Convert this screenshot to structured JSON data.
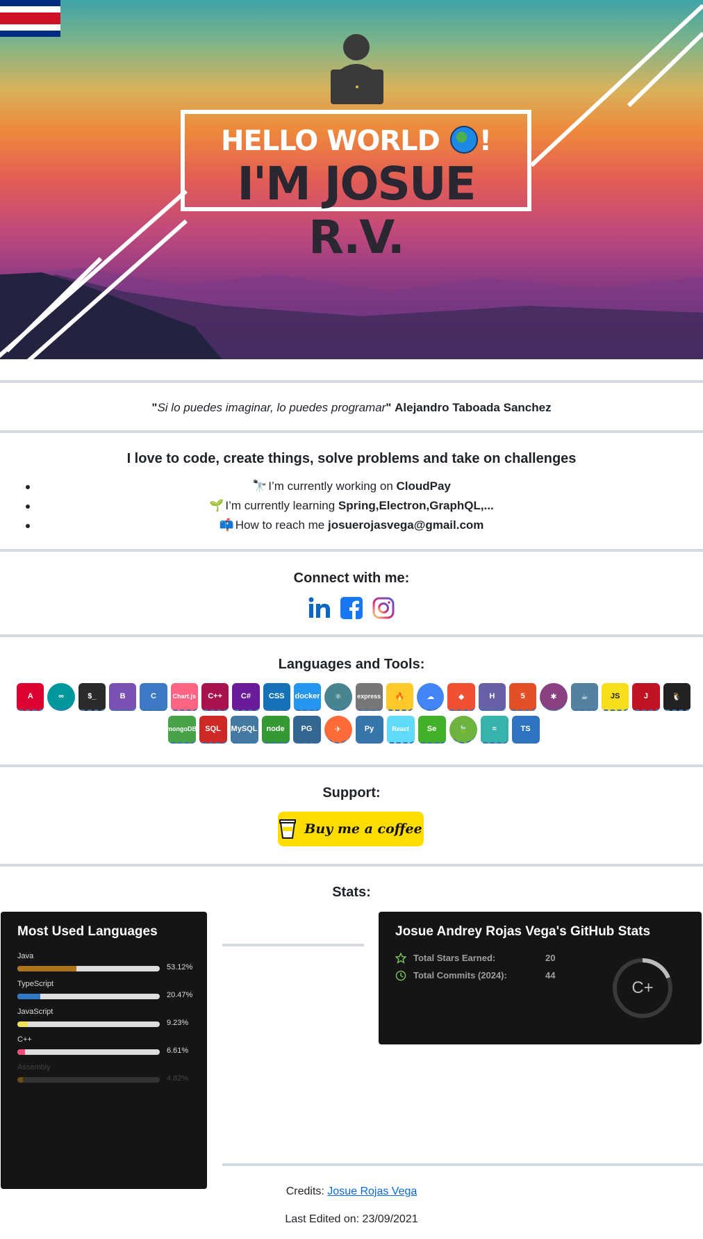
{
  "banner": {
    "hello": "HELLO WORLD",
    "exclaim": "!",
    "name": "I'M JOSUE R.V."
  },
  "quote": {
    "open_quote": "\"",
    "text": "Si lo puedes imaginar, lo puedes programar",
    "close_quote": "\"",
    "author": "Alejandro Taboada Sanchez"
  },
  "intro": {
    "heading": "I love to code, create things, solve problems and take on challenges",
    "items": [
      {
        "emoji": "🔭",
        "prefix": "I’m currently working on ",
        "bold": "CloudPay"
      },
      {
        "emoji": "🌱",
        "prefix": "I’m currently learning ",
        "bold": "Spring,Electron,GraphQL,..."
      },
      {
        "emoji": "📫",
        "prefix": "How to reach me ",
        "bold": "josuerojasvega@gmail.com"
      }
    ]
  },
  "connect": {
    "heading": "Connect with me:",
    "icons": [
      "linkedin-icon",
      "facebook-icon",
      "instagram-icon"
    ]
  },
  "tools": {
    "heading": "Languages and Tools:",
    "row1": [
      {
        "name": "angular",
        "text": "A",
        "bg": "#dd0031"
      },
      {
        "name": "arduino",
        "text": "∞",
        "bg": "#00979d"
      },
      {
        "name": "bash",
        "text": "$_",
        "bg": "#2b2b2b"
      },
      {
        "name": "bootstrap",
        "text": "B",
        "bg": "#7952b3"
      },
      {
        "name": "c",
        "text": "C",
        "bg": "#3c7ac5"
      },
      {
        "name": "chartjs",
        "text": "Chart.js",
        "bg": "#ff6384"
      },
      {
        "name": "cplusplus",
        "text": "C++",
        "bg": "#a8124e"
      },
      {
        "name": "csharp",
        "text": "C#",
        "bg": "#6a1b9a"
      },
      {
        "name": "css3",
        "text": "CSS",
        "bg": "#1572b6"
      },
      {
        "name": "docker",
        "text": "docker",
        "bg": "#2496ed"
      },
      {
        "name": "electron",
        "text": "⚛",
        "bg": "#47848f"
      },
      {
        "name": "express",
        "text": "express",
        "bg": "#777777"
      },
      {
        "name": "firebase",
        "text": "🔥",
        "bg": "#ffca28"
      },
      {
        "name": "gcp",
        "text": "☁",
        "bg": "#4285f4"
      },
      {
        "name": "git",
        "text": "◆",
        "bg": "#f05032"
      },
      {
        "name": "heroku",
        "text": "H",
        "bg": "#6762a6"
      },
      {
        "name": "html5",
        "text": "5",
        "bg": "#e34f26"
      },
      {
        "name": "jasmine",
        "text": "✱",
        "bg": "#8a4182"
      },
      {
        "name": "java",
        "text": "☕",
        "bg": "#5382a1"
      },
      {
        "name": "javascript",
        "text": "JS",
        "bg": "#f7df1e"
      },
      {
        "name": "jest",
        "text": "J",
        "bg": "#c21325"
      },
      {
        "name": "linux",
        "text": "🐧",
        "bg": "#222222"
      }
    ],
    "row2": [
      {
        "name": "mongodb",
        "text": "mongoDB",
        "bg": "#47a248"
      },
      {
        "name": "mssql",
        "text": "SQL",
        "bg": "#cc2927"
      },
      {
        "name": "mysql",
        "text": "MySQL",
        "bg": "#4479a1"
      },
      {
        "name": "nodejs",
        "text": "node",
        "bg": "#339933"
      },
      {
        "name": "postgresql",
        "text": "PG",
        "bg": "#336791"
      },
      {
        "name": "postman",
        "text": "✈",
        "bg": "#ff6c37"
      },
      {
        "name": "python",
        "text": "Py",
        "bg": "#3776ab"
      },
      {
        "name": "react",
        "text": "React",
        "bg": "#61dafb"
      },
      {
        "name": "selenium",
        "text": "Se",
        "bg": "#43b02a"
      },
      {
        "name": "spring",
        "text": "🍃",
        "bg": "#6db33f"
      },
      {
        "name": "tailwind",
        "text": "≈",
        "bg": "#38b2ac"
      },
      {
        "name": "typescript",
        "text": "TS",
        "bg": "#2f74c0"
      }
    ]
  },
  "support": {
    "heading": "Support:",
    "button": "Buy me a coffee"
  },
  "stats": {
    "heading": "Stats:",
    "languages_card": {
      "title": "Most Used Languages",
      "langs": [
        {
          "name": "Java",
          "pct": "53.12%",
          "value": 53.12,
          "color": "#b07219"
        },
        {
          "name": "TypeScript",
          "pct": "20.47%",
          "value": 20.47,
          "color": "#3178c6"
        },
        {
          "name": "JavaScript",
          "pct": "9.23%",
          "value": 9.23,
          "color": "#f1e05a"
        },
        {
          "name": "C++",
          "pct": "6.61%",
          "value": 6.61,
          "color": "#f34b7d"
        },
        {
          "name": "Assembly",
          "pct": "4.82%",
          "value": 4.82,
          "color": "#6e4c13"
        }
      ]
    },
    "github_card": {
      "title": "Josue Andrey Rojas Vega's GitHub Stats",
      "stars_label": "Total Stars Earned:",
      "stars": "20",
      "commits_label": "Total Commits (2024):",
      "commits": "44",
      "grade": "C+"
    }
  },
  "footer": {
    "credits_label": "Credits: ",
    "credits_link": "Josue Rojas Vega",
    "edited": "Last Edited on: 23/09/2021"
  }
}
